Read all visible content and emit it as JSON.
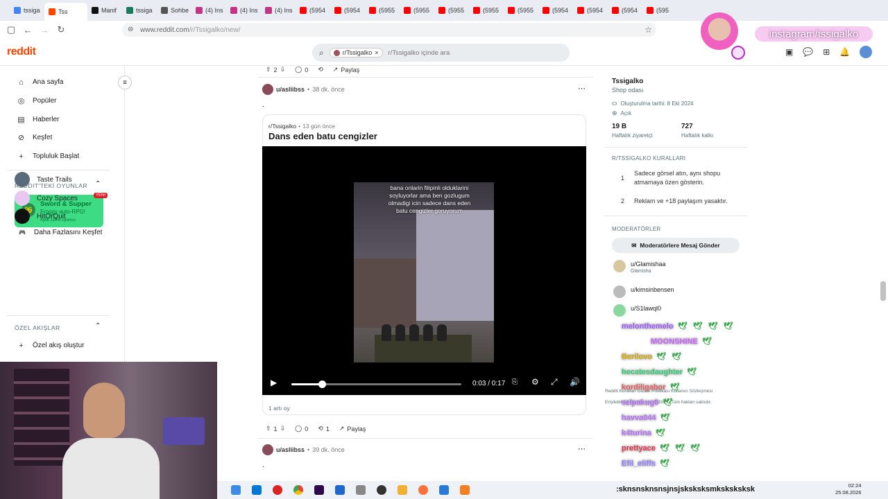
{
  "browser": {
    "tabs": [
      {
        "label": "tssiga",
        "color": "#4285f4"
      },
      {
        "label": "Tss",
        "color": "#ff4500"
      },
      {
        "label": "Manif",
        "color": "#111111"
      },
      {
        "label": "tssiga",
        "color": "#1a7a5a"
      },
      {
        "label": "Sohbe",
        "color": "#555555"
      },
      {
        "label": "(4) Ins",
        "color": "#c13584"
      },
      {
        "label": "(4) Ins",
        "color": "#c13584"
      },
      {
        "label": "(4) Ins",
        "color": "#c13584"
      },
      {
        "label": "(5954",
        "color": "#ff0000"
      },
      {
        "label": "(5954",
        "color": "#ff0000"
      },
      {
        "label": "(5955",
        "color": "#ff0000"
      },
      {
        "label": "(5955",
        "color": "#ff0000"
      },
      {
        "label": "(5955",
        "color": "#ff0000"
      },
      {
        "label": "(5955",
        "color": "#ff0000"
      },
      {
        "label": "(5955",
        "color": "#ff0000"
      },
      {
        "label": "(5954",
        "color": "#ff0000"
      },
      {
        "label": "(5954",
        "color": "#ff0000"
      },
      {
        "label": "(5954",
        "color": "#ff0000"
      },
      {
        "label": "(595",
        "color": "#ff0000"
      }
    ],
    "url_host": "www.reddit.com",
    "url_path": "/r/Tssigalko/new/"
  },
  "reddit": {
    "logo": "reddit",
    "search_chip": "r/Tssigalko",
    "search_placeholder": "r/Tssigalko içinde ara"
  },
  "leftnav": {
    "items": [
      {
        "label": "Ana sayfa",
        "icon": "home-icon"
      },
      {
        "label": "Popüler",
        "icon": "popular-icon"
      },
      {
        "label": "Haberler",
        "icon": "news-icon"
      },
      {
        "label": "Keşfet",
        "icon": "explore-icon"
      },
      {
        "label": "Topluluk Başlat",
        "icon": "plus-icon"
      }
    ],
    "games_header": "REDDIT'TEKİ OYUNLAR",
    "featured_game": {
      "title": "Sword & Supper",
      "subtitle": "Froggy auto-RPG!",
      "meta": "Aylık 119 B oyuncu",
      "badge": "YENİ",
      "color": "#3ddc84"
    },
    "games": [
      "Taste Trails",
      "Cozy Spaces",
      "HitOrQuit",
      "Daha Fazlasını Keşfet"
    ],
    "feeds_header": "ÖZEL AKIŞLAR",
    "create_feed": "Özel akış oluştur"
  },
  "feed": {
    "top_post": {
      "votes": "2",
      "comments": "0",
      "share": "Paylaş"
    },
    "post": {
      "author": "u/asliibss",
      "time": "38 dk. önce",
      "body": ".",
      "crosspost": {
        "subreddit": "r/Tssigalko",
        "time": "13 gün önce",
        "title": "Dans eden batu cengizler",
        "video_caption": "bana onlarin filipinli olduklarini soyluyorlar ama ben gozlugum olmadigi icin sadece dans eden batu cengizler goruyorum",
        "time_display": "0:03 / 0:17",
        "progress": 0.18,
        "upvote_text": "1 artı oy"
      },
      "votes": "1",
      "comments": "0",
      "reposts": "1",
      "share": "Paylaş"
    },
    "next_post": {
      "author": "u/asliibss",
      "time": "39 dk. önce",
      "body": "."
    }
  },
  "sidebar": {
    "name": "Tssigalko",
    "subtitle": "Shop odası",
    "created": "Oluşturulma tarihi: 8 Eki 2024",
    "visibility": "Açık",
    "stats": [
      {
        "value": "19 B",
        "label": "Haftalık ziyaretçi"
      },
      {
        "value": "727",
        "label": "Haftalık katkı"
      }
    ],
    "rules_header": "R/TSSIGALKO KURALLARI",
    "rules": [
      {
        "num": "1",
        "text": "Sadece görsel atın, aynı shopu atmamaya özen gösterin."
      },
      {
        "num": "2",
        "text": "Reklam ve +18 paylaşım yasaktır."
      }
    ],
    "mods_header": "MODERATÖRLER",
    "message_mods": "Moderatörlere Mesaj Gönder",
    "mods": [
      {
        "name": "u/Glamishaa",
        "flair": "Glamisha"
      },
      {
        "name": "u/kimsinbensen",
        "flair": ""
      },
      {
        "name": "u/S1lawql0",
        "flair": ""
      }
    ],
    "footer1": "Reddit Kuralları  Gizlilik Politikası  Kullanıcı Sözleşmesi",
    "footer2": "Erişilebilirlik  Reddit, Inc. © 2025. Tüm hakları saklıdır."
  },
  "overlay": {
    "instagram": "instagram/tssigalko",
    "chat": [
      {
        "user": "melonthemelo",
        "color": "#9b59ff",
        "birds": 4
      },
      {
        "user": "MOONSHINE",
        "color": "#c85cff",
        "birds": 1
      },
      {
        "user": "Berilovo",
        "color": "#d4a800",
        "birds": 2
      },
      {
        "user": "hecatesdaughter",
        "color": "#2ecc71",
        "birds": 1
      },
      {
        "user": "kordiligabor",
        "color": "#e05a5a",
        "birds": 1
      },
      {
        "user": "szipakug0",
        "color": "#b56cff",
        "birds": 1
      },
      {
        "user": "havva044",
        "color": "#b56cff",
        "birds": 1
      },
      {
        "user": "k4turina",
        "color": "#b56cff",
        "birds": 1
      },
      {
        "user": "prettyace",
        "color": "#e0304a",
        "birds": 3
      },
      {
        "user": "Efil_eliffs",
        "color": "#8e7cff",
        "birds": 1
      }
    ],
    "ticker": ":sknsnsknsnsjnsjsksksksmksksksksk"
  },
  "taskbar": {
    "time": "02:24",
    "date": "25.08.2026"
  }
}
